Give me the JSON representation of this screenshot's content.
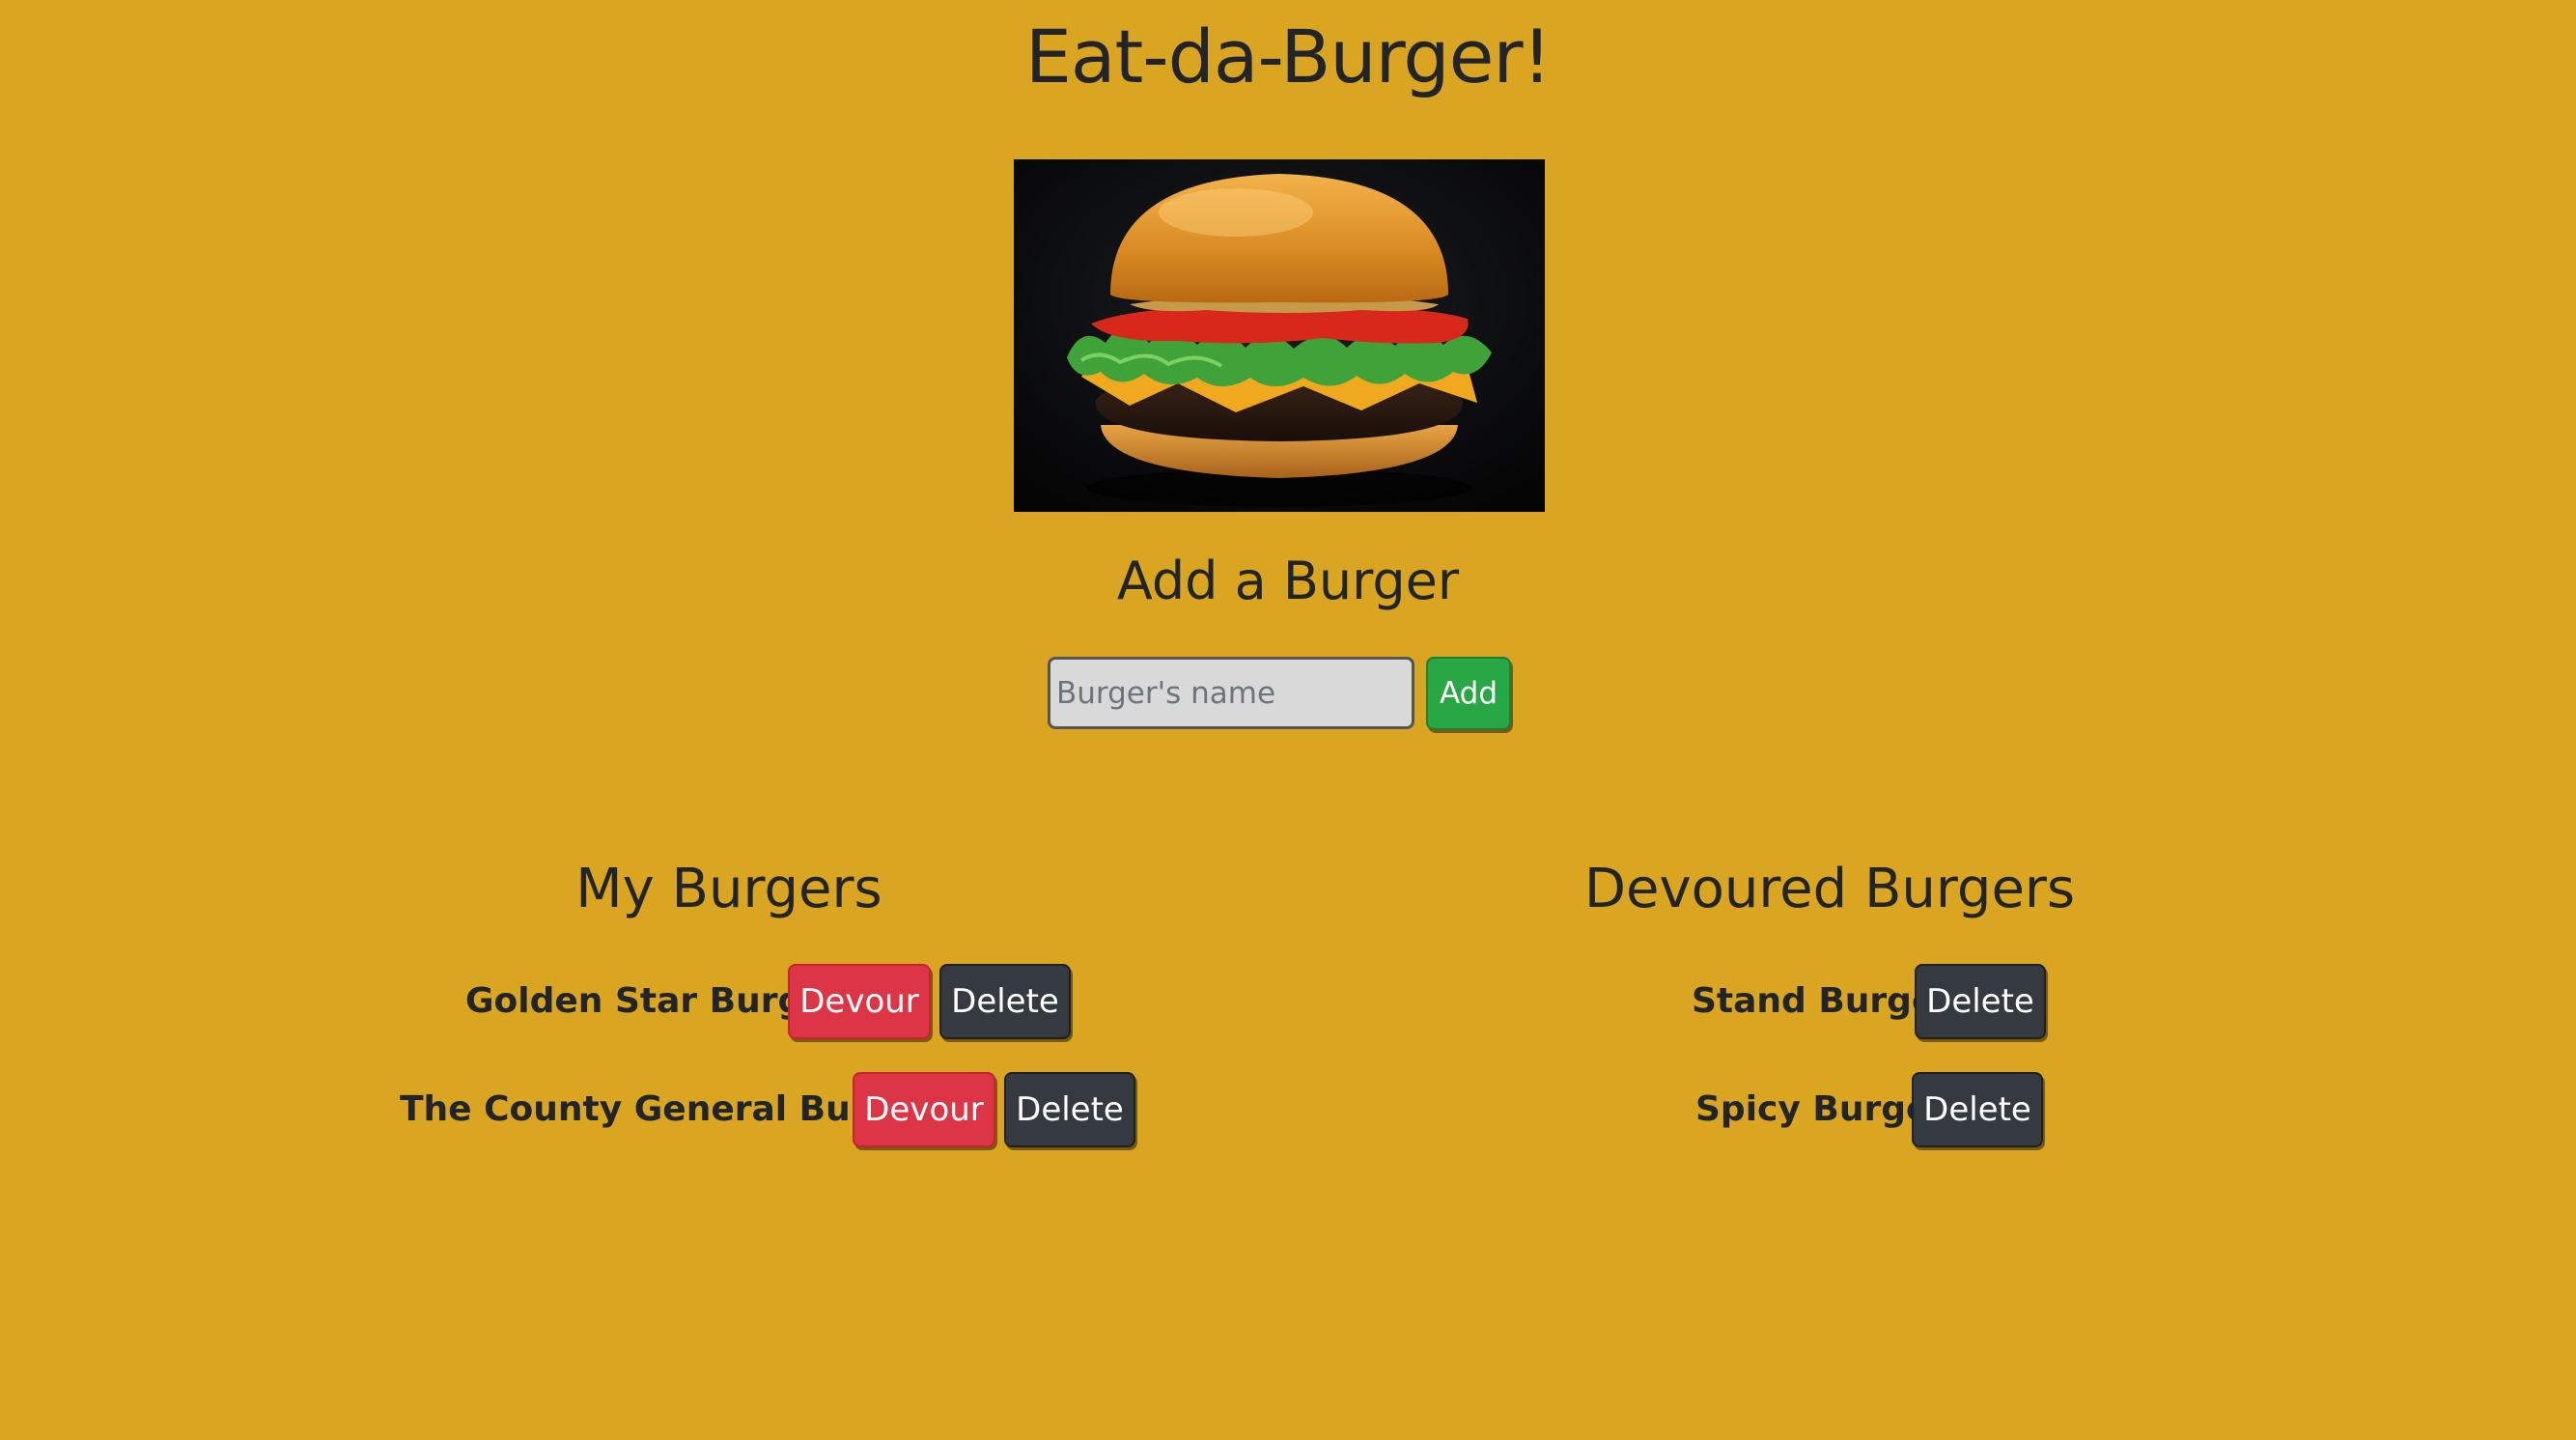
{
  "header": {
    "title": "Eat-da-Burger!"
  },
  "hero_image": {
    "description_icon": "burger-photo"
  },
  "add_form": {
    "title": "Add a Burger",
    "input_placeholder": "Burger's name",
    "input_value": "",
    "add_label": "Add"
  },
  "my_burgers": {
    "title": "My Burgers",
    "items": [
      {
        "name": "Golden Star Burger",
        "devour_label": "Devour",
        "delete_label": "Delete"
      },
      {
        "name": "The County General Burger",
        "devour_label": "Devour",
        "delete_label": "Delete"
      }
    ]
  },
  "devoured_burgers": {
    "title": "Devoured Burgers",
    "items": [
      {
        "name": "Stand Burger",
        "delete_label": "Delete"
      },
      {
        "name": "Spicy Burger",
        "delete_label": "Delete"
      }
    ]
  },
  "colors": {
    "background": "#daa520",
    "add_button": "#28a745",
    "devour_button": "#dc3545",
    "delete_button": "#343a40"
  }
}
